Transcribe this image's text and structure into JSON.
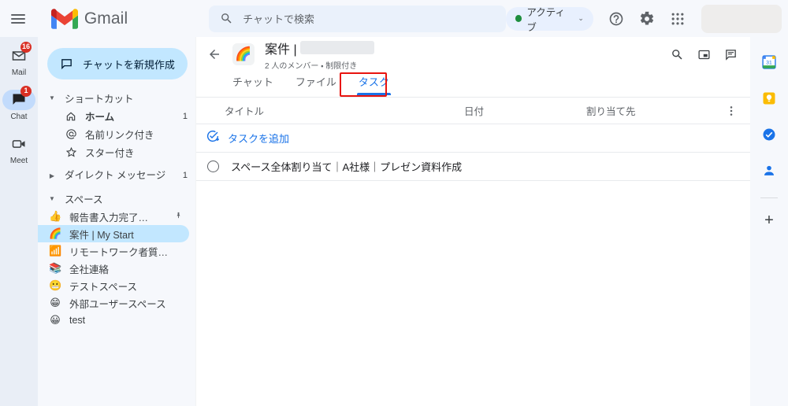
{
  "topbar": {
    "menu_icon": "hamburger-menu-icon",
    "brand": "Gmail",
    "search": {
      "icon": "search-icon",
      "placeholder": "チャットで検索",
      "value": ""
    },
    "status": {
      "label": "アクティブ",
      "dot_color": "#1e8e3e",
      "chevron": "⌄"
    },
    "help_icon": "help-circle-icon",
    "settings_icon": "gear-icon",
    "apps_icon": "apps-grid-icon",
    "avatar": "redacted-avatar"
  },
  "rail": {
    "items": [
      {
        "label": "Mail",
        "icon": "mail-icon",
        "badge": "16",
        "active": false
      },
      {
        "label": "Chat",
        "icon": "chat-icon",
        "badge": "1",
        "active": true
      },
      {
        "label": "Meet",
        "icon": "meet-camera-icon",
        "badge": "",
        "active": false
      }
    ]
  },
  "sidebar": {
    "compose": {
      "label": "チャットを新規作成",
      "icon": "new-chat-icon"
    },
    "nav": [
      {
        "label": "ショートカット",
        "icon": "caret-down-icon",
        "kind": "section",
        "count": ""
      },
      {
        "label": "ホーム",
        "icon": "home-icon",
        "kind": "item",
        "count": "1",
        "bold": true
      },
      {
        "label": "名前リンク付き",
        "icon": "at-mention-icon",
        "kind": "item",
        "count": ""
      },
      {
        "label": "スター付き",
        "icon": "star-icon",
        "kind": "item",
        "count": ""
      },
      {
        "label": "ダイレクト メッセージ",
        "icon": "caret-right-icon",
        "kind": "section-collapsed",
        "count": "1"
      },
      {
        "label": "スペース",
        "icon": "caret-down-icon",
        "kind": "section",
        "count": ""
      }
    ],
    "spaces": [
      {
        "label": "報告書入力完了…",
        "emoji": "👍",
        "pin": "📌",
        "selected": false
      },
      {
        "label": "案件 | My Start",
        "emoji": "🌈",
        "pin": "",
        "selected": true
      },
      {
        "label": "リモートワーク者質…",
        "emoji": "📶",
        "pin": "",
        "selected": false
      },
      {
        "label": "全社連絡",
        "emoji": "📚",
        "pin": "",
        "selected": false
      },
      {
        "label": "テストスペース",
        "emoji": "😬",
        "pin": "",
        "selected": false
      },
      {
        "label": "外部ユーザースペース",
        "emoji": "😁",
        "pin": "",
        "selected": false
      },
      {
        "label": "test",
        "emoji": "😀",
        "pin": "",
        "selected": false
      }
    ]
  },
  "space": {
    "back_icon": "arrow-left-icon",
    "avatar_emoji": "🌈",
    "title": "案件 |",
    "title_redacted": true,
    "subtitle": "2 人のメンバー ・ 制限付き",
    "actions": [
      {
        "icon": "search-icon",
        "name": "space-search-button"
      },
      {
        "icon": "picture-in-picture-icon",
        "name": "picture-in-picture-button"
      },
      {
        "icon": "chat-bubble-icon",
        "name": "space-chat-button"
      }
    ],
    "tabs": [
      {
        "label": "チャット",
        "active": false
      },
      {
        "label": "ファイル",
        "active": false
      },
      {
        "label": "タスク",
        "active": true,
        "annotated": true
      }
    ]
  },
  "tasks": {
    "columns": {
      "title": "タイトル",
      "date": "日付",
      "assignee": "割り当て先",
      "menu_icon": "more-vert-icon"
    },
    "add_task": {
      "label": "タスクを追加",
      "icon": "add-task-icon"
    },
    "rows": [
      {
        "title": "スペース全体割り当て｜A社様｜プレゼン資料作成",
        "date": "",
        "assignee": "",
        "completed": false
      }
    ]
  },
  "side_apps": {
    "items": [
      {
        "name": "calendar-app-icon",
        "label": "Calendar",
        "day": "31"
      },
      {
        "name": "keep-app-icon",
        "label": "Keep"
      },
      {
        "name": "tasks-app-icon",
        "label": "Tasks"
      },
      {
        "name": "contacts-app-icon",
        "label": "Contacts"
      }
    ],
    "add": {
      "label": "+",
      "name": "add-app-icon"
    }
  },
  "colors": {
    "accent_blue": "#1a73e8",
    "annotation_red": "#e8140f",
    "selected_blue": "#c2e7ff",
    "rail_bg": "#e9eef6",
    "page_bg": "#f6f8fc",
    "badge_red": "#d93025",
    "status_green": "#1e8e3e"
  }
}
